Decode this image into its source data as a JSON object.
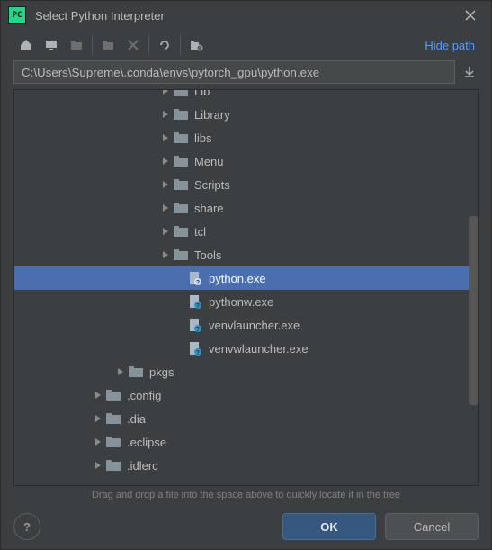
{
  "window": {
    "title": "Select Python Interpreter"
  },
  "toolbar": {
    "hide_path": "Hide path"
  },
  "path": {
    "value": "C:\\Users\\Supreme\\.conda\\envs\\pytorch_gpu\\python.exe"
  },
  "tree": {
    "rows": [
      {
        "indent": 160,
        "expand": "right",
        "icon": "folder",
        "label": "Lib",
        "selected": false
      },
      {
        "indent": 160,
        "expand": "right",
        "icon": "folder",
        "label": "Library",
        "selected": false
      },
      {
        "indent": 160,
        "expand": "right",
        "icon": "folder",
        "label": "libs",
        "selected": false
      },
      {
        "indent": 160,
        "expand": "right",
        "icon": "folder",
        "label": "Menu",
        "selected": false
      },
      {
        "indent": 160,
        "expand": "right",
        "icon": "folder",
        "label": "Scripts",
        "selected": false
      },
      {
        "indent": 160,
        "expand": "right",
        "icon": "folder",
        "label": "share",
        "selected": false
      },
      {
        "indent": 160,
        "expand": "right",
        "icon": "folder",
        "label": "tcl",
        "selected": false
      },
      {
        "indent": 160,
        "expand": "right",
        "icon": "folder",
        "label": "Tools",
        "selected": false
      },
      {
        "indent": 176,
        "expand": "none",
        "icon": "file",
        "label": "python.exe",
        "selected": true
      },
      {
        "indent": 176,
        "expand": "none",
        "icon": "file",
        "label": "pythonw.exe",
        "selected": false
      },
      {
        "indent": 176,
        "expand": "none",
        "icon": "file",
        "label": "venvlauncher.exe",
        "selected": false
      },
      {
        "indent": 176,
        "expand": "none",
        "icon": "file",
        "label": "venvwlauncher.exe",
        "selected": false
      },
      {
        "indent": 110,
        "expand": "right",
        "icon": "folder",
        "label": "pkgs",
        "selected": false
      },
      {
        "indent": 85,
        "expand": "right",
        "icon": "folder",
        "label": ".config",
        "selected": false
      },
      {
        "indent": 85,
        "expand": "right",
        "icon": "folder",
        "label": ".dia",
        "selected": false
      },
      {
        "indent": 85,
        "expand": "right",
        "icon": "folder",
        "label": ".eclipse",
        "selected": false
      },
      {
        "indent": 85,
        "expand": "right",
        "icon": "folder",
        "label": ".idlerc",
        "selected": false
      }
    ],
    "hint": "Drag and drop a file into the space above to quickly locate it in the tree"
  },
  "buttons": {
    "ok": "OK",
    "cancel": "Cancel",
    "help": "?"
  },
  "icons": {
    "home": "home-icon",
    "desktop": "desktop-icon",
    "new_folder": "new-folder-icon",
    "new_folder_x": "new-folder-disabled-icon",
    "delete": "delete-icon",
    "refresh": "refresh-icon",
    "show_hidden": "toggle-hidden-icon",
    "download": "download-icon"
  }
}
